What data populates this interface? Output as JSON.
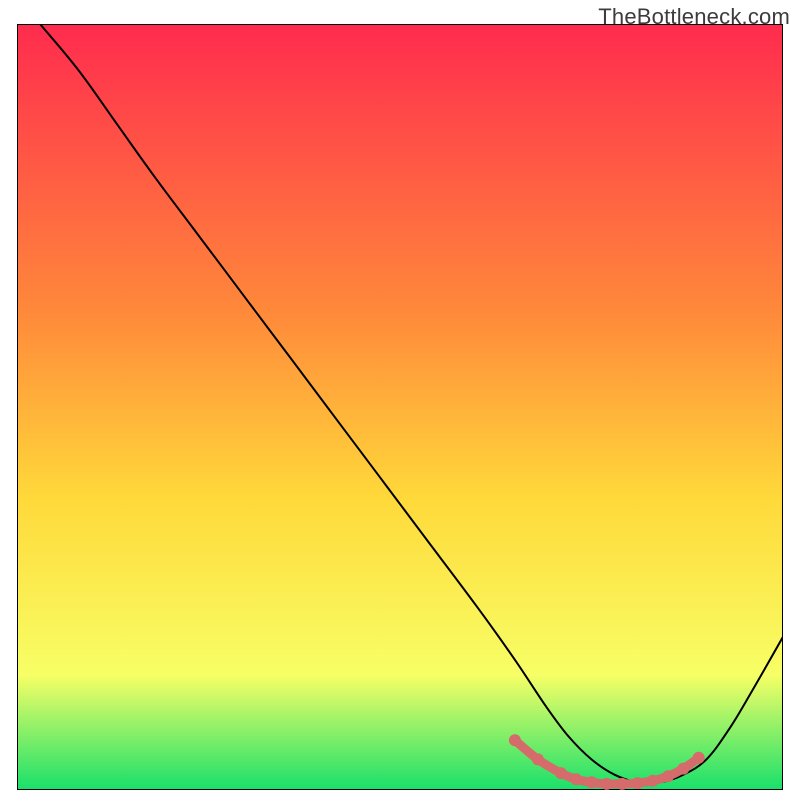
{
  "watermark": "TheBottleneck.com",
  "chart_data": {
    "type": "line",
    "title": "",
    "xlabel": "",
    "ylabel": "",
    "xlim": [
      0,
      100
    ],
    "ylim": [
      0,
      100
    ],
    "gradient_colors": {
      "top": "#ff2b4e",
      "mid_upper": "#ff8a3a",
      "mid": "#ffd93a",
      "low": "#f7ff66",
      "bottom": "#18e06b"
    },
    "series": [
      {
        "name": "bottleneck-curve",
        "color": "#000000",
        "x": [
          3,
          8,
          13,
          18,
          24,
          30,
          36,
          42,
          48,
          54,
          60,
          65,
          69,
          72,
          75,
          78,
          81,
          84,
          87,
          90,
          93,
          96,
          100
        ],
        "y": [
          100,
          94,
          87,
          80,
          72,
          64,
          56,
          48,
          40,
          32,
          24,
          17,
          11,
          7,
          4,
          2,
          1,
          1,
          2,
          4,
          8,
          13,
          20
        ]
      },
      {
        "name": "highlighted-floor",
        "color": "#d66b6b",
        "marker": true,
        "x": [
          65,
          68,
          71,
          73,
          75,
          77,
          79,
          81,
          83,
          85,
          87,
          89
        ],
        "y": [
          6.5,
          4.0,
          2.2,
          1.4,
          1.0,
          0.8,
          0.8,
          0.9,
          1.2,
          1.8,
          2.8,
          4.2
        ]
      }
    ]
  }
}
